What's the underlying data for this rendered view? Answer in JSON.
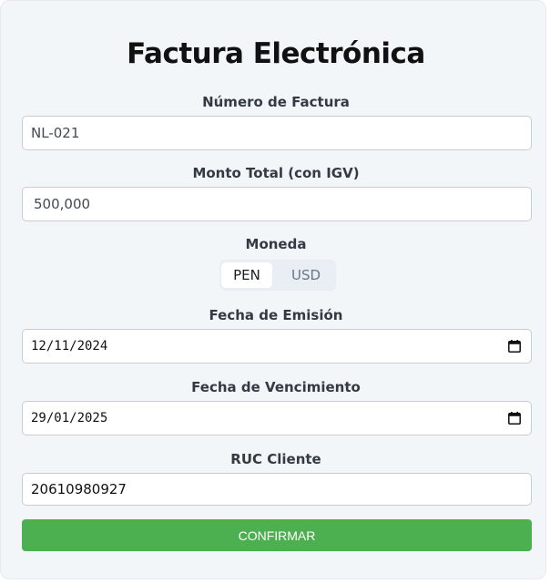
{
  "form": {
    "title": "Factura Electrónica",
    "invoice_number": {
      "label": "Número de Factura",
      "value": "NL-021"
    },
    "total_amount": {
      "label": "Monto Total (con IGV)",
      "value": "500,000"
    },
    "currency": {
      "label": "Moneda",
      "options": [
        "PEN",
        "USD"
      ],
      "selected": "PEN"
    },
    "issue_date": {
      "label": "Fecha de Emisión",
      "value": "12/11/2024"
    },
    "due_date": {
      "label": "Fecha de Vencimiento",
      "value": "29/01/2025"
    },
    "client_ruc": {
      "label": "RUC Cliente",
      "value": "20610980927"
    },
    "submit_label": "CONFIRMAR"
  },
  "colors": {
    "card_background": "#f3f6f9",
    "submit_button": "#4caf50",
    "toggle_background": "#e9eef4"
  },
  "icons": [
    "calendar-icon"
  ]
}
